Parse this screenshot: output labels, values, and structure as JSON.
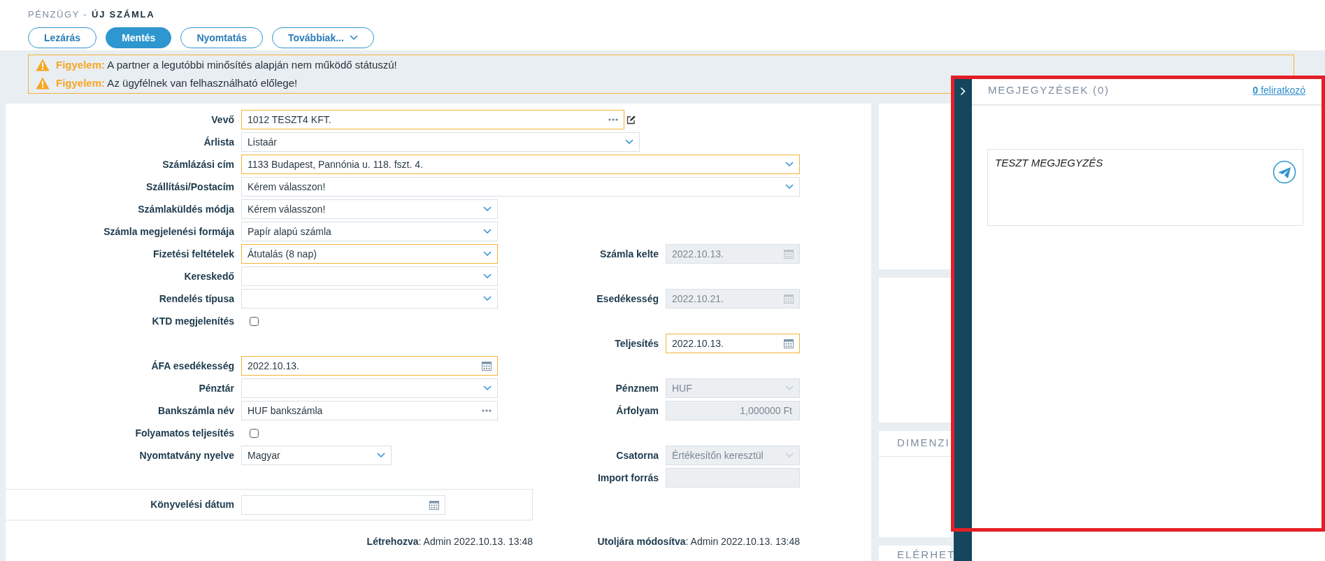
{
  "breadcrumb": {
    "section": "PÉNZÜGY -",
    "page": "ÚJ SZÁMLA"
  },
  "toolbar": [
    {
      "label": "Lezárás",
      "kind": "button"
    },
    {
      "label": "Mentés",
      "kind": "primary"
    },
    {
      "label": "Nyomtatás",
      "kind": "button"
    },
    {
      "label": "Továbbiak...",
      "kind": "dropdown"
    }
  ],
  "warnings": [
    "**Figyelem:** A partner a legutóbbi minősítés alapján nem működő státuszú!",
    "**Figyelem:** Az ügyfélnek van felhasználható előlege!"
  ],
  "form": {
    "rows": [
      {
        "left": {
          "label": "Vevő",
          "kind": "lookup",
          "value": "1012 TESZT4 KFT.",
          "editable": true,
          "highlighted": true,
          "disabled": false
        }
      },
      {
        "left": {
          "label": "Árlista",
          "kind": "select",
          "value": "Listaár",
          "highlighted": false,
          "disabled": false
        }
      },
      {
        "left": {
          "label": "Számlázási cím",
          "kind": "select",
          "value": "1133 Budapest, Pannónia u. 118. fszt. 4.",
          "highlighted": true,
          "disabled": false
        }
      },
      {
        "left": {
          "label": "Szállítási/Postacím",
          "kind": "select",
          "value": "Kérem válasszon!",
          "highlighted": false,
          "disabled": false
        }
      },
      {
        "left": {
          "label": "Számlaküldés módja",
          "kind": "select",
          "value": "Kérem válasszon!",
          "highlighted": false,
          "disabled": false
        }
      },
      {
        "left": {
          "label": "Számla megjelenési formája",
          "kind": "select",
          "value": "Papír alapú számla",
          "highlighted": false,
          "disabled": false
        }
      },
      {
        "left": {
          "label": "Fizetési feltételek",
          "kind": "select",
          "value": "Átutalás (8 nap)",
          "highlighted": true,
          "disabled": false
        },
        "right": {
          "label": "Számla kelte",
          "kind": "date",
          "value": "2022.10.13.",
          "highlighted": false,
          "disabled": true
        }
      },
      {
        "left": {
          "label": "Kereskedő",
          "kind": "select",
          "highlighted": false,
          "disabled": false
        }
      },
      {
        "left": {
          "label": "Rendelés típusa",
          "kind": "select",
          "highlighted": false,
          "disabled": false
        },
        "right": {
          "label": "Esedékesség",
          "kind": "date",
          "value": "2022.10.21.",
          "highlighted": false,
          "disabled": true
        }
      },
      {
        "left": {
          "label": "KTD megjelenítés",
          "kind": "checkbox",
          "checked": false
        }
      },
      {
        "right": {
          "label": "Teljesítés",
          "kind": "date",
          "value": "2022.10.13.",
          "highlighted": true,
          "disabled": false
        }
      },
      {
        "left": {
          "label": "ÁFA esedékesség",
          "kind": "date",
          "value": "2022.10.13.",
          "highlighted": true,
          "disabled": false
        }
      },
      {
        "left": {
          "label": "Pénztár",
          "kind": "select",
          "highlighted": false,
          "disabled": false
        },
        "right": {
          "label": "Pénznem",
          "kind": "select",
          "value": "HUF",
          "highlighted": false,
          "disabled": true
        }
      },
      {
        "left": {
          "label": "Bankszámla név",
          "kind": "lookup",
          "value": "HUF bankszámla",
          "editable": false,
          "highlighted": false,
          "disabled": false
        },
        "right": {
          "label": "Árfolyam",
          "kind": "number",
          "value": "1,000000 Ft",
          "highlighted": false,
          "disabled": true
        }
      },
      {
        "left": {
          "label": "Folyamatos teljesítés",
          "kind": "checkbox",
          "checked": false
        }
      },
      {
        "left": {
          "label": "Nyomtatvány nyelve",
          "kind": "select",
          "value": "Magyar",
          "highlighted": false,
          "disabled": false
        },
        "right": {
          "label": "Csatorna",
          "kind": "select",
          "value": "Értékesítőn keresztül",
          "highlighted": false,
          "disabled": true
        }
      },
      {
        "right": {
          "label": "Import forrás",
          "kind": "text",
          "highlighted": false,
          "disabled": true
        }
      }
    ],
    "posting_date": {
      "label": "Könyvelési dátum",
      "kind": "date",
      "highlighted": false,
      "disabled": false
    },
    "audit": [
      "**Létrehozva**: Admin 2022.10.13. 13:48",
      "**Utoljára módosítva**: Admin 2022.10.13. 13:48"
    ]
  },
  "side_cards": [
    {
      "kind": "plain"
    },
    {
      "kind": "plain"
    },
    {
      "kind": "titled",
      "title": "DIMENZI"
    },
    {
      "kind": "titled",
      "title": "ELÉRHET"
    }
  ],
  "notes_panel": {
    "title": "MEGJEGYZÉSEK (0)",
    "subscribers": "**0** feliratkozó",
    "comment": {
      "value": "TESZT MEGJEGYZÉS"
    }
  }
}
